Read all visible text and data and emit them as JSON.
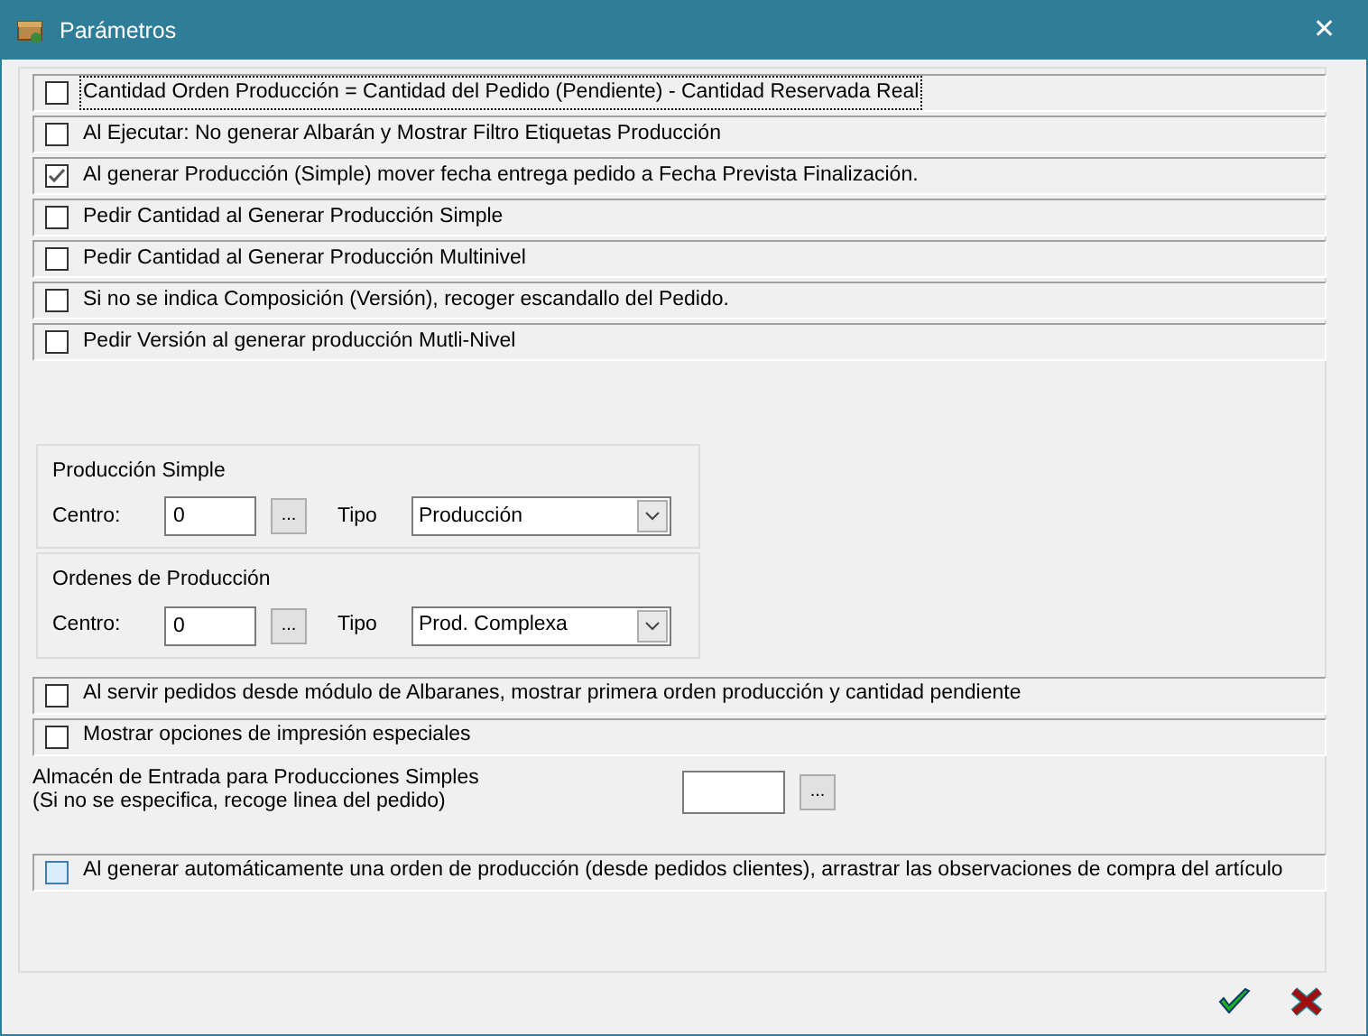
{
  "window": {
    "title": "Parámetros",
    "close": "✕"
  },
  "options_top": [
    {
      "label": "Cantidad Orden Producción = Cantidad del Pedido (Pendiente) - Cantidad Reservada Real",
      "checked": false,
      "focused": true
    },
    {
      "label": "Al Ejecutar: No generar Albarán y Mostrar Filtro Etiquetas Producción",
      "checked": false,
      "focused": false
    },
    {
      "label": "Al generar Producción (Simple) mover fecha entrega pedido a Fecha Prevista Finalización.",
      "checked": true,
      "focused": false
    },
    {
      "label": "Pedir Cantidad al Generar Producción Simple",
      "checked": false,
      "focused": false
    },
    {
      "label": "Pedir Cantidad al Generar Producción Multinivel",
      "checked": false,
      "focused": false
    },
    {
      "label": "Si no se indica Composición (Versión), recoger escandallo del Pedido.",
      "checked": false,
      "focused": false
    },
    {
      "label": "Pedir Versión al generar producción Mutli-Nivel",
      "checked": false,
      "focused": false
    }
  ],
  "groups": [
    {
      "title": "Producción Simple",
      "centro_label": "Centro:",
      "centro_value": "0",
      "browse": "...",
      "tipo_label": "Tipo",
      "tipo_value": "Producción"
    },
    {
      "title": "Ordenes de Producción",
      "centro_label": "Centro:",
      "centro_value": "0",
      "browse": "...",
      "tipo_label": "Tipo",
      "tipo_value": "Prod. Complexa"
    }
  ],
  "options_mid": [
    {
      "label": "Al servir pedidos desde módulo de Albaranes, mostrar primera orden producción y cantidad pendiente",
      "checked": false,
      "hovered": false
    },
    {
      "label": "Mostrar opciones de impresión especiales",
      "checked": false,
      "hovered": false
    }
  ],
  "almacen": {
    "label_line1": "Almacén de Entrada para Producciones Simples",
    "label_line2": "(Si no se especifica, recoge linea del pedido)",
    "browse": "..."
  },
  "options_bottom": [
    {
      "label": "Al generar automáticamente una orden de producción (desde pedidos clientes), arrastrar las observaciones de compra del artículo",
      "checked": false,
      "hovered": true
    }
  ]
}
